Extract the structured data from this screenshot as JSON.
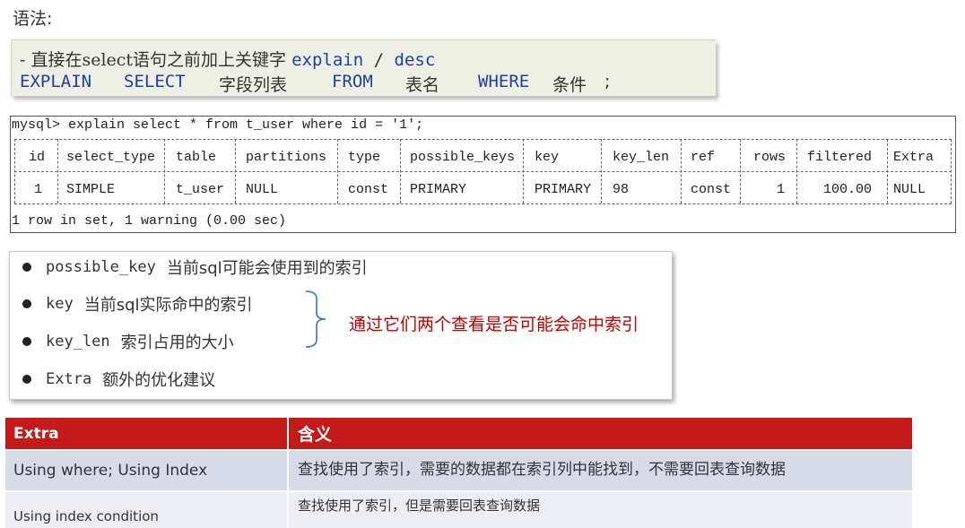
{
  "heading": "语法:",
  "syntax": {
    "line1_prefix": "- 直接在select语句之前加上关键字 ",
    "line1_kw1": "explain",
    "line1_sep": " / ",
    "line1_kw2": "desc",
    "line2_tokens": [
      "EXPLAIN",
      "SELECT",
      "字段列表",
      "FROM",
      "表名",
      "WHERE",
      "条件",
      ";"
    ]
  },
  "console": {
    "command": "mysql> explain select * from t_user where id = '1';",
    "headers": [
      "id",
      "select_type",
      "table",
      "partitions",
      "type",
      "possible_keys",
      "key",
      "key_len",
      "ref",
      "rows",
      "filtered",
      "Extra"
    ],
    "row": [
      "1",
      "SIMPLE",
      "t_user",
      "NULL",
      "const",
      "PRIMARY",
      "PRIMARY",
      "98",
      "const",
      "1",
      "100.00",
      "NULL"
    ],
    "status": "1 row in set, 1 warning (0.00 sec)"
  },
  "bullets": [
    {
      "term": "possible_key",
      "desc": "当前sql可能会使用到的索引"
    },
    {
      "term": "key",
      "desc": "当前sql实际命中的索引"
    },
    {
      "term": "key_len",
      "desc": "索引占用的大小"
    },
    {
      "term": "Extra",
      "desc": "额外的优化建议"
    }
  ],
  "brace_note": "通过它们两个查看是否可能会命中索引",
  "extra_table": {
    "headers": [
      "Extra",
      "含义"
    ],
    "rows": [
      [
        "Using where; Using Index",
        "查找使用了索引，需要的数据都在索引列中能找到，不需要回表查询数据"
      ],
      [
        "Using index condition",
        "查找使用了索引，但是需要回表查询数据"
      ]
    ]
  },
  "colors": {
    "accent_red": "#c41a1a",
    "keyword_blue": "#1f3fa8",
    "note_red": "#c00000"
  }
}
